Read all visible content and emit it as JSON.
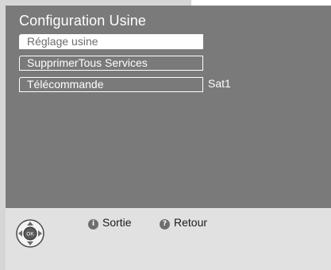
{
  "screen": {
    "title": "Configuration Usine",
    "menu": [
      {
        "label": "Réglage usine",
        "value": ""
      },
      {
        "label": "SupprimerTous Services",
        "value": ""
      },
      {
        "label": "Télécommande",
        "value": "Sat1"
      }
    ]
  },
  "footer": {
    "remote_icon": "remote-dpad-ok-icon",
    "remote_ok_label": "OK",
    "hints": [
      {
        "icon": "info-button-icon",
        "glyph": "i",
        "label": "Sortie"
      },
      {
        "icon": "back-button-icon",
        "glyph": "?",
        "label": "Retour"
      }
    ]
  }
}
